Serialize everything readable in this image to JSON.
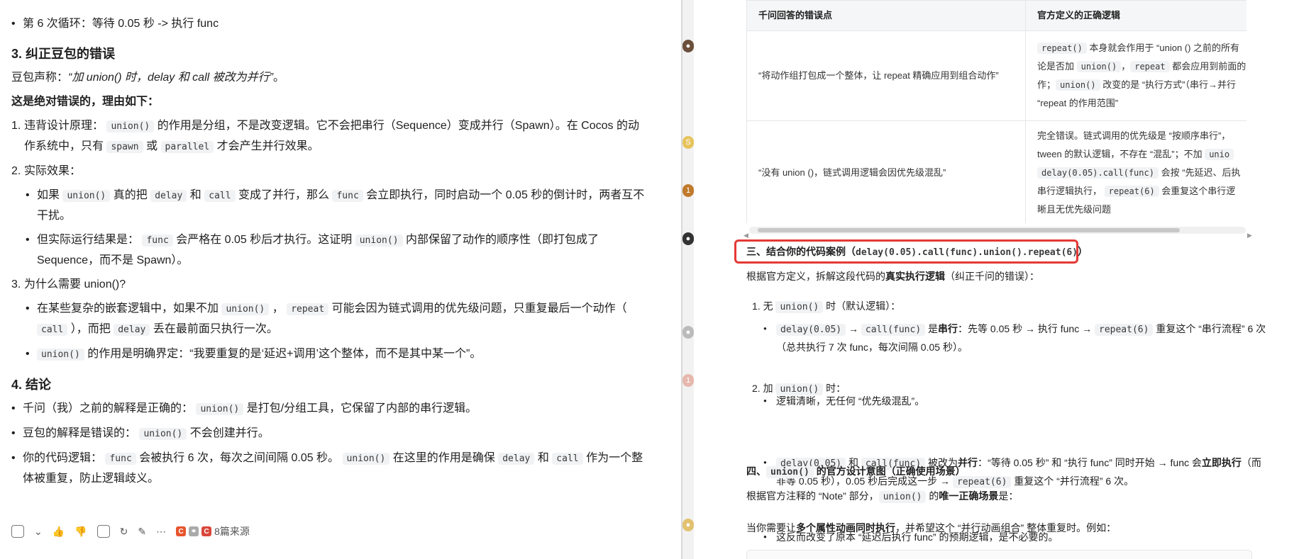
{
  "left": {
    "loop6": "第 6 次循环：等待 0.05 秒 -> 执行 func",
    "s3_title": "3. 纠正豆包的错误",
    "claim_prefix": "豆包声称：",
    "claim_quote": "“加 union() 时，delay 和 call 被改为并行”",
    "claim_suffix": "。",
    "wrong_title": "这是绝对错误的，理由如下：",
    "p1": {
      "n": "1.",
      "a": "违背设计原理：",
      "c1": "union()",
      "b": "的作用是分组，不是改变逻辑。它不会把串行（Sequence）变成并行（Spawn）。在 Cocos 的动作系统中，只有",
      "c2": "spawn",
      "d": "或",
      "c3": "parallel",
      "e": "才会产生并行效果。"
    },
    "p2": {
      "n": "2.",
      "a": "实际效果："
    },
    "p2a": {
      "a": "如果",
      "c1": "union()",
      "b": "真的把",
      "c2": "delay",
      "c": "和",
      "c3": "call",
      "d": "变成了并行，那么",
      "c4": "func",
      "e": "会立即执行，同时启动一个 0.05 秒的倒计时，两者互不干扰。"
    },
    "p2b": {
      "a": "但实际运行结果是：",
      "c1": "func",
      "b": "会严格在 0.05 秒后才执行。这证明",
      "c2": "union()",
      "c": "内部保留了动作的顺序性（即打包成了 Sequence，而不是 Spawn）。"
    },
    "p3": {
      "n": "3.",
      "a": "为什么需要 union()?"
    },
    "p3a": {
      "a": "在某些复杂的嵌套逻辑中，如果不加",
      "c1": "union()",
      "b": "，",
      "c2": "repeat",
      "c": "可能会因为链式调用的优先级问题，只重复最后一个动作（",
      "c3": "call",
      "d": "），而把",
      "c4": "delay",
      "e": "丢在最前面只执行一次。"
    },
    "p3b": {
      "c1": "union()",
      "a": "的作用是明确界定：“我要重复的是‘延迟+调用’这个整体，而不是其中某一个”。"
    },
    "s4_title": "4. 结论",
    "c1": {
      "a": "千问（我）之前的解释是正确的：",
      "c1": "union()",
      "b": "是打包/分组工具，它保留了内部的串行逻辑。"
    },
    "c2": {
      "a": "豆包的解释是错误的：",
      "c1": "union()",
      "b": "不会创建并行。"
    },
    "c3": {
      "a": "你的代码逻辑：",
      "c1": "func",
      "b": "会被执行 6 次，每次之间间隔 0.05 秒。",
      "c2": "union()",
      "c": "在这里的作用是确保",
      "c3": "delay",
      "d": "和",
      "c4": "call",
      "e": "作为一个整体被重复，防止逻辑歧义。"
    },
    "sources_label": "8篇来源"
  },
  "right": {
    "th1": "千问回答的错误点",
    "th2": "官方定义的正确逻辑",
    "r1c1": "“将动作组打包成一个整体，让 repeat 精确应用到组合动作”",
    "r1c2": {
      "c1": "repeat()",
      "a": "本身就会作用于 “union () 之前的所有",
      "b": "论是否加",
      "c2": "union()",
      "c": "，",
      "c3": "repeat",
      "d": "都会应用到前面的",
      "e": "作；",
      "c4": "union()",
      "f": "改变的是 “执行方式”（串行→并行",
      "g": "“repeat 的作用范围”"
    },
    "r2c1": "“没有 union ()，链式调用逻辑会因优先级混乱”",
    "r2c2": {
      "a": "完全错误。链式调用的优先级是 “按顺序串行”，",
      "b": "tween 的默认逻辑，不存在 “混乱”；不加",
      "c1": "unio",
      "c2": "delay(0.05).call(func)",
      "c": "会按 “先延迟、后执",
      "d": "串行逻辑执行，",
      "c3": "repeat(6)",
      "e": "会重复这个串行逻",
      "f": "晰且无优先级问题"
    },
    "s3_title_a": "三、结合你的代码案例（",
    "s3_code": "delay(0.05).call(func).union().repeat(6)",
    "s3_title_b": "）",
    "intro_a": "根据官方定义，拆解这段代码的",
    "intro_b": "真实执行逻辑",
    "intro_c": "（纠正千问的错误）：",
    "i1": {
      "n": "1.",
      "a": "无",
      "c1": "union()",
      "b": "时（默认逻辑）："
    },
    "i1a": {
      "c1": "delay(0.05)",
      "a": "→",
      "c2": "call(func)",
      "b": "是",
      "bb": "串行",
      "c": "：先等 0.05 秒 → 执行 func →",
      "c3": "repeat(6)",
      "d": "重复这个 “串行流程” 6 次",
      "e": "（总共执行 7 次 func，每次间隔 0.05 秒）。"
    },
    "i1b": "逻辑清晰，无任何 “优先级混乱”。",
    "i2": {
      "n": "2.",
      "a": "加",
      "c1": "union()",
      "b": "时："
    },
    "i2a": {
      "c1": "delay(0.05)",
      "a": "和",
      "c2": "call(func)",
      "b": "被改为",
      "bb": "并行",
      "c": "：“等待 0.05 秒” 和 “执行 func” 同时开始 → func 会",
      "cc": "立即执行",
      "d": "（而",
      "e": "非等 0.05 秒），0.05 秒后完成这一步 →",
      "c3": "repeat(6)",
      "f": "重复这个 “并行流程” 6 次。"
    },
    "i2b": "这反而改变了原本 “延迟后执行 func” 的预期逻辑，是不必要的。",
    "s4_a": "四、",
    "s4_code": "union()",
    "s4_b": "的官方设计意图（正确使用场景）",
    "note_a": "根据官方注释的 “Note” 部分，",
    "note_code": "union()",
    "note_b": "的",
    "note_bb": "唯一正确场景",
    "note_c": "是：",
    "when_a": "当你需要让",
    "when_b": "多个属性动画同时执行",
    "when_c": "，并希望这个 “并行动画组合” 整体重复时。例如："
  },
  "colors": {
    "highlight": "#e53935",
    "src1": "#e8542d",
    "src2": "#d9473a"
  }
}
